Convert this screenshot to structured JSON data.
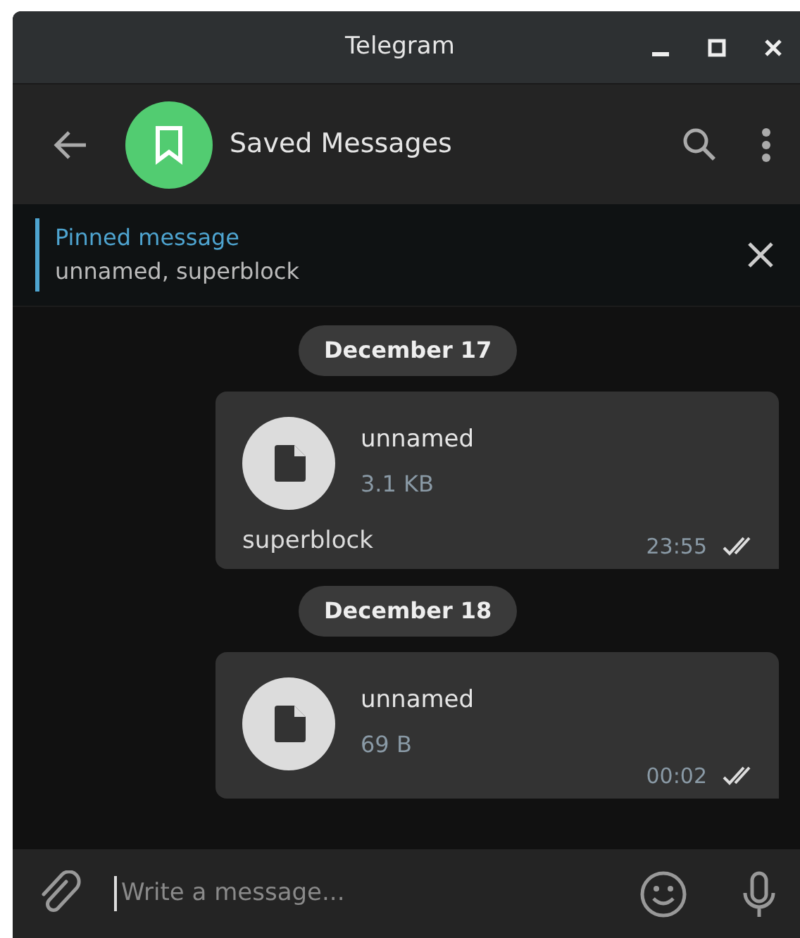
{
  "window": {
    "title": "Telegram"
  },
  "chat": {
    "title": "Saved Messages"
  },
  "pinned": {
    "label": "Pinned message",
    "text": "unnamed, superblock"
  },
  "messages": [
    {
      "date": "December 17",
      "file_name": "unnamed",
      "file_size": "3.1 KB",
      "caption": "superblock",
      "time": "23:55",
      "read": true
    },
    {
      "date": "December 18",
      "file_name": "unnamed",
      "file_size": "69 B",
      "time": "00:02",
      "read": true
    }
  ],
  "composer": {
    "placeholder": "Write a message..."
  }
}
